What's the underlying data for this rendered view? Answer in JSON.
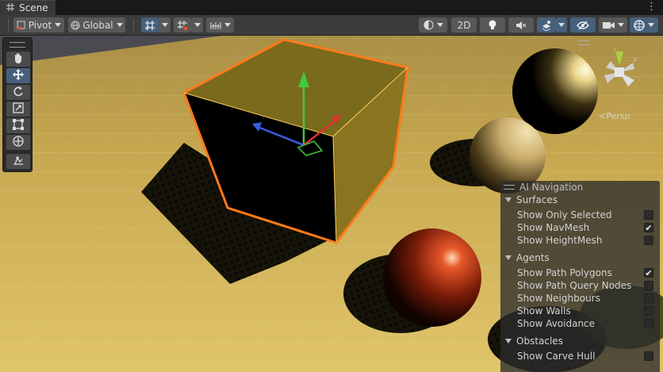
{
  "tab": {
    "title": "Scene",
    "icon": "grid-icon"
  },
  "toolbar": {
    "pivot_label": "Pivot",
    "global_label": "Global",
    "mode_2d_label": "2D"
  },
  "gizmo": {
    "projection_label": "Persp",
    "axes": [
      "x",
      "y",
      "z"
    ]
  },
  "tools": [
    "hand",
    "move",
    "rotate",
    "scale",
    "rect",
    "transform",
    "custom"
  ],
  "selected_tool": "move",
  "ai_navigation": {
    "title": "AI Navigation",
    "sections": [
      {
        "name": "Surfaces",
        "items": [
          {
            "label": "Show Only Selected",
            "checked": false
          },
          {
            "label": "Show NavMesh",
            "checked": true
          },
          {
            "label": "Show HeightMesh",
            "checked": false
          }
        ]
      },
      {
        "name": "Agents",
        "items": [
          {
            "label": "Show Path Polygons",
            "checked": true
          },
          {
            "label": "Show Path Query Nodes",
            "checked": false
          },
          {
            "label": "Show Neighbours",
            "checked": false
          },
          {
            "label": "Show Walls",
            "checked": false
          },
          {
            "label": "Show Avoidance",
            "checked": false
          }
        ]
      },
      {
        "name": "Obstacles",
        "items": [
          {
            "label": "Show Carve Hull",
            "checked": false
          }
        ]
      }
    ]
  },
  "colors": {
    "accent": "#46607c",
    "selection_outline": "#ff7a1a",
    "ground": "#c8a850",
    "axis_x": "#e03030",
    "axis_y": "#3ccc3c",
    "axis_z": "#3a5be0"
  }
}
